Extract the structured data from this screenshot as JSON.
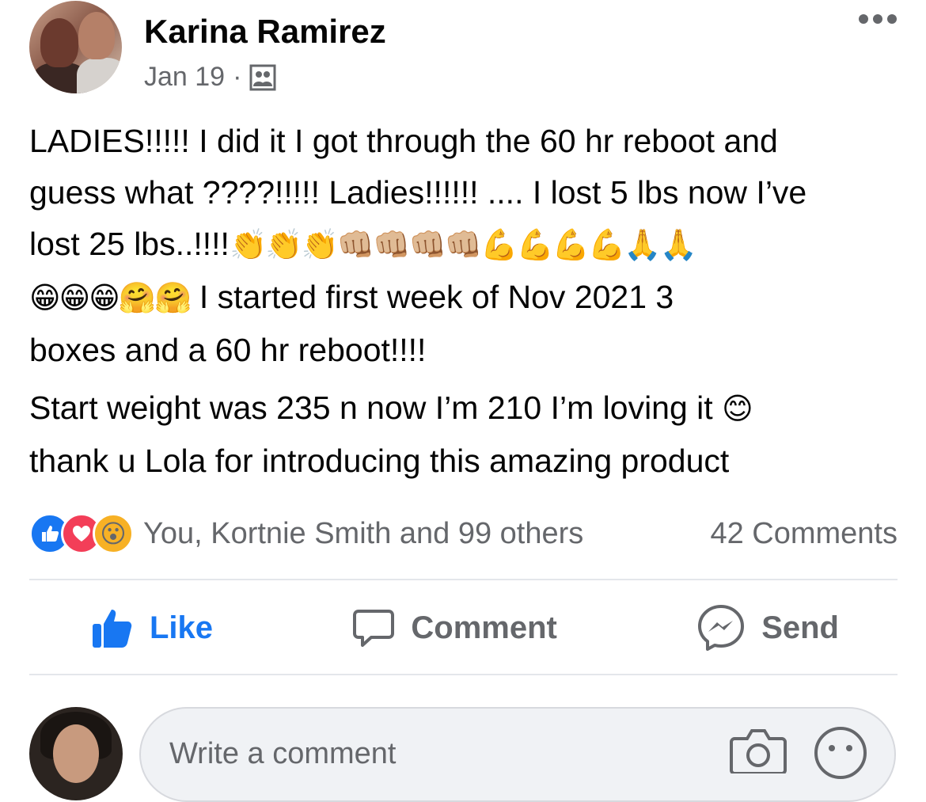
{
  "post": {
    "author": "Karina Ramirez",
    "date": "Jan 19",
    "separator": "·",
    "audience_icon": "friends-icon",
    "more_icon": "more-options-icon",
    "text": {
      "line1": "LADIES!!!!! I did it I got through the 60 hr reboot and",
      "line2": "guess what ????!!!!! Ladies!!!!!! .... I lost 5 lbs now I’ve",
      "line3_text": "lost 25 lbs..!!!!",
      "line3_emoji": "👏👏👏👊🏼👊🏼👊🏼👊🏼💪💪💪💪🙏🙏",
      "line4_emoji": "😁😁😁🤗🤗",
      "line4_text": " I started first week of Nov 2021 3",
      "line5": "boxes and a 60 hr reboot!!!!",
      "line6_text": "Start weight was 235 n now I’m 210 I’m loving it ",
      "line6_emoji": "😊",
      "line7": "thank u Lola for introducing this amazing product"
    }
  },
  "reactions": {
    "icons": [
      "like-reaction-icon",
      "love-reaction-icon",
      "wow-reaction-icon"
    ],
    "wow_emoji": "😮",
    "names": "You, Kortnie Smith and 99 others",
    "comments": "42 Comments"
  },
  "actions": {
    "like": "Like",
    "comment": "Comment",
    "send": "Send"
  },
  "comment_input": {
    "placeholder": "Write a comment"
  },
  "colors": {
    "accent": "#1877f2",
    "secondary_text": "#65676b",
    "divider": "#e4e6eb"
  }
}
